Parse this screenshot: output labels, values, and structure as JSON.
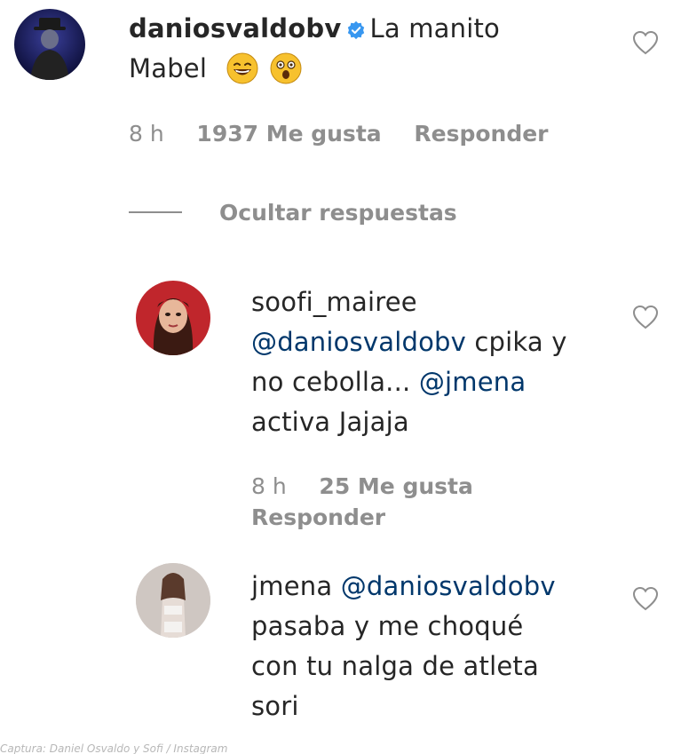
{
  "main_comment": {
    "username": "daniosvaldobv",
    "text_line1": "La manito",
    "text_line2": "Mabel",
    "emojis": [
      "grinning-face-emoji",
      "astonished-face-emoji"
    ],
    "time": "8 h",
    "likes": "1937 Me gusta",
    "reply_label": "Responder",
    "verified": true
  },
  "hide_replies_label": "Ocultar respuestas",
  "replies": [
    {
      "username": "soofi_mairee",
      "mention1": "@daniosvaldobv",
      "text1": " cpika y",
      "text2": "no cebolla... ",
      "mention2": "@jmena",
      "text3": "activa Jajaja",
      "time": "8 h",
      "likes": "25 Me gusta",
      "reply_label": "Responder"
    },
    {
      "username": "jmena",
      "mention1": "@daniosvaldobv",
      "line2": "pasaba y me choqué",
      "line3": "con tu nalga de atleta",
      "line4": "sori"
    }
  ],
  "caption": "Captura: Daniel Osvaldo y Sofi / Instagram",
  "colors": {
    "text": "#262626",
    "secondary": "#8e8e8e",
    "mention": "#00376b",
    "verified": "#3897f0"
  }
}
